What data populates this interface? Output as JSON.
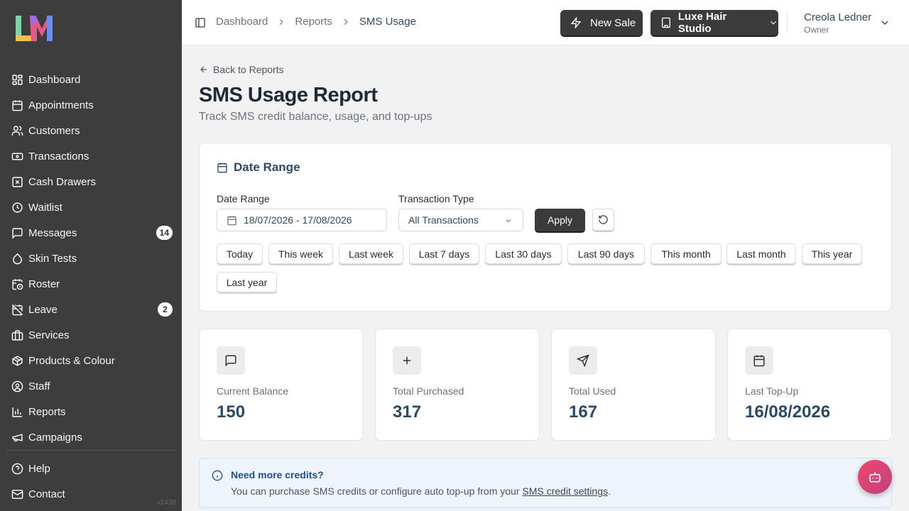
{
  "sidebar": {
    "items": [
      {
        "label": "Dashboard",
        "icon": "grid-icon"
      },
      {
        "label": "Appointments",
        "icon": "calendar-icon"
      },
      {
        "label": "Customers",
        "icon": "users-icon"
      },
      {
        "label": "Transactions",
        "icon": "banknote-icon"
      },
      {
        "label": "Cash Drawers",
        "icon": "square-x-icon"
      },
      {
        "label": "Waitlist",
        "icon": "clock-icon"
      },
      {
        "label": "Messages",
        "icon": "message-icon",
        "badge": "14"
      },
      {
        "label": "Skin Tests",
        "icon": "droplet-icon"
      },
      {
        "label": "Roster",
        "icon": "calendar-clock-icon"
      },
      {
        "label": "Leave",
        "icon": "calendar-off-icon",
        "badge": "2"
      },
      {
        "label": "Services",
        "icon": "briefcase-icon"
      },
      {
        "label": "Products & Colour",
        "icon": "package-icon"
      },
      {
        "label": "Staff",
        "icon": "user-circle-icon"
      },
      {
        "label": "Reports",
        "icon": "bar-chart-icon"
      },
      {
        "label": "Campaigns",
        "icon": "megaphone-icon"
      }
    ],
    "bottom_items": [
      {
        "label": "Help",
        "icon": "help-circle-icon"
      },
      {
        "label": "Contact",
        "icon": "mail-icon"
      }
    ],
    "version": "v2438"
  },
  "header": {
    "breadcrumb": [
      "Dashboard",
      "Reports",
      "SMS Usage"
    ],
    "new_sale_label": "New Sale",
    "studio_label": "Luxe Hair Studio",
    "user_name": "Creola Ledner",
    "user_role": "Owner"
  },
  "page": {
    "back_label": "Back to Reports",
    "title": "SMS Usage Report",
    "subtitle": "Track SMS credit balance, usage, and top-ups"
  },
  "date_card": {
    "title": "Date Range",
    "date_label": "Date Range",
    "date_value": "18/07/2026 - 17/08/2026",
    "type_label": "Transaction Type",
    "type_value": "All Transactions",
    "apply_label": "Apply",
    "presets": [
      "Today",
      "This week",
      "Last week",
      "Last 7 days",
      "Last 30 days",
      "Last 90 days",
      "This month",
      "Last month",
      "This year",
      "Last year"
    ]
  },
  "stats": [
    {
      "label": "Current Balance",
      "value": "150",
      "icon": "message-square-icon"
    },
    {
      "label": "Total Purchased",
      "value": "317",
      "icon": "plus-icon"
    },
    {
      "label": "Total Used",
      "value": "167",
      "icon": "send-icon"
    },
    {
      "label": "Last Top-Up",
      "value": "16/08/2026",
      "icon": "calendar-icon"
    }
  ],
  "info": {
    "title": "Need more credits?",
    "text_before": "You can purchase SMS credits or configure auto top-up from your ",
    "link": "SMS credit settings",
    "text_after": "."
  },
  "colors": {
    "sidebar_bg": "#3d3d3d",
    "accent_text": "#2b4a66",
    "dark_button": "#3b3b3b",
    "info_bg": "#eef4fb",
    "info_title": "#1e4e9a"
  }
}
